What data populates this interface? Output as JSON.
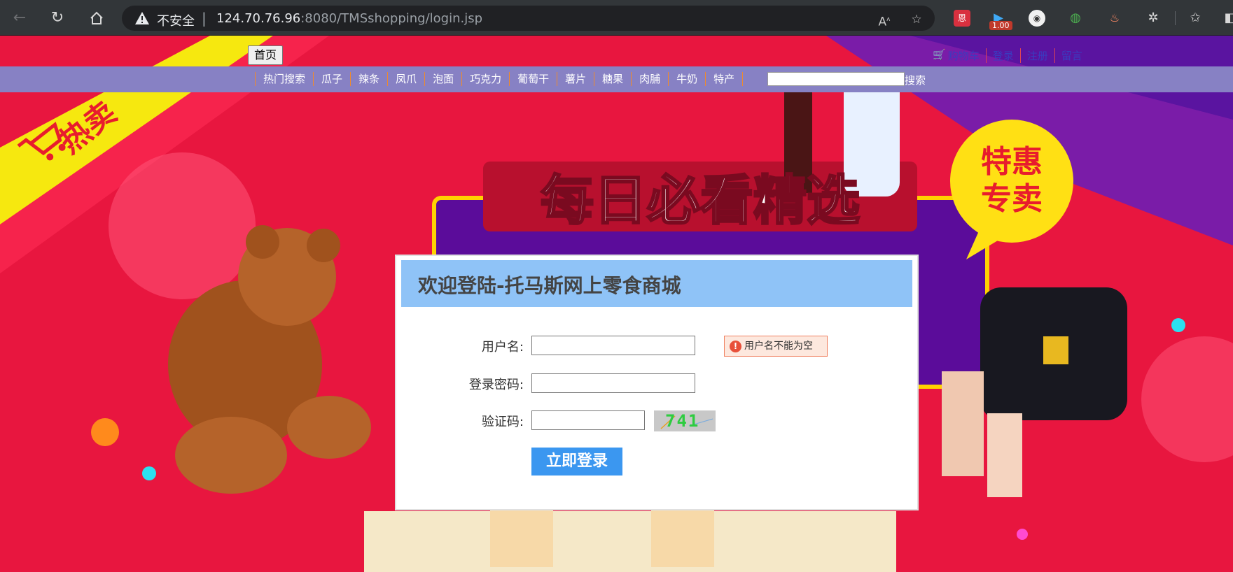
{
  "browser": {
    "security_label": "不安全",
    "url_host": "124.70.76.96",
    "url_rest": ":8080/TMSshopping/login.jsp",
    "extension_badge": "1.00",
    "ext_badge_color": "#c0392b"
  },
  "site": {
    "home_button": "首页",
    "top_links": [
      "购物车",
      "登录",
      "注册",
      "留言"
    ],
    "categories": [
      "热门搜索",
      "瓜子",
      "辣条",
      "凤爪",
      "泡面",
      "巧克力",
      "葡萄干",
      "薯片",
      "糖果",
      "肉脯",
      "牛奶",
      "特产"
    ],
    "search_button": "搜索",
    "search_value": "",
    "nav_color": "#8781c4"
  },
  "banner": {
    "headline": "每日必看精选",
    "badge_line1": "特惠",
    "badge_line2": "专卖",
    "ribbon": "热卖"
  },
  "login": {
    "title": "欢迎登陆-托马斯网上零食商城",
    "username_label": "用户名:",
    "username_value": "",
    "username_error": "用户名不能为空",
    "password_label": "登录密码:",
    "password_value": "",
    "captcha_label": "验证码:",
    "captcha_value": "",
    "captcha_image_text": "741",
    "submit_label": "立即登录",
    "header_color": "#8fc3f7",
    "button_color": "#3b97f0"
  }
}
